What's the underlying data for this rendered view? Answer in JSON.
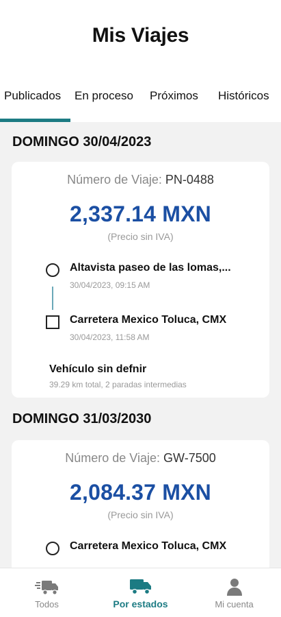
{
  "header": {
    "title": "Mis Viajes"
  },
  "tabs": [
    {
      "label": "Publicados"
    },
    {
      "label": "En proceso"
    },
    {
      "label": "Próximos"
    },
    {
      "label": "Históricos"
    }
  ],
  "active_tab": "Publicados",
  "groups": [
    {
      "date": "DOMINGO 30/04/2023",
      "trip": {
        "number_label": "Número de Viaje:",
        "number": "PN-0488",
        "price": "2,337.14 MXN",
        "price_note": "(Precio sin IVA)",
        "stops": [
          {
            "address": "Altavista paseo de las lomas,...",
            "time": "30/04/2023, 09:15 AM",
            "marker": "circle"
          },
          {
            "address": "Carretera Mexico Toluca, CMX",
            "time": "30/04/2023, 11:58 AM",
            "marker": "square"
          }
        ],
        "vehicle": "Vehículo sin defnir",
        "vehicle_detail": "39.29 km total, 2 paradas intermedias"
      }
    },
    {
      "date": "DOMINGO 31/03/2030",
      "trip": {
        "number_label": "Número de Viaje:",
        "number": "GW-7500",
        "price": "2,084.37 MXN",
        "price_note": "(Precio sin IVA)",
        "stops": [
          {
            "address": "Carretera Mexico Toluca, CMX",
            "marker": "circle"
          }
        ]
      }
    }
  ],
  "bottom_nav": [
    {
      "label": "Todos",
      "icon": "truck-fast-icon"
    },
    {
      "label": "Por estados",
      "icon": "truck-icon"
    },
    {
      "label": "Mi cuenta",
      "icon": "user-icon"
    }
  ],
  "colors": {
    "accent": "#1c7b83",
    "price": "#1b4fa3",
    "background": "#f2f2f2"
  }
}
